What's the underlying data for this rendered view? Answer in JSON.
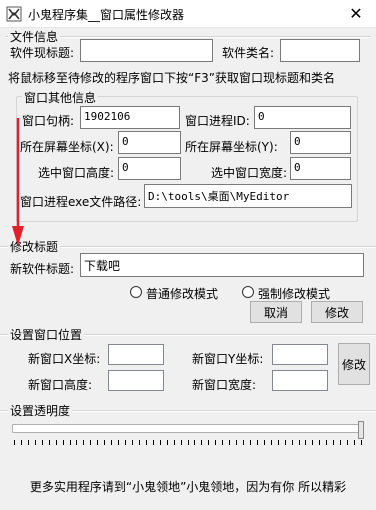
{
  "window": {
    "title": "小鬼程序集__窗口属性修改器",
    "close_glyph": "✕"
  },
  "file_info": {
    "legend": "文件信息",
    "caption_label": "软件现标题:",
    "caption_value": "",
    "class_label": "软件类名:",
    "class_value": "",
    "hint": "将鼠标移至待修改的程序窗口下按“F3”获取窗口现标题和类名"
  },
  "window_info": {
    "legend": "窗口其他信息",
    "handle_label": "窗口句柄:",
    "handle_value": "1902106",
    "pid_label": "窗口进程ID:",
    "pid_value": "0",
    "x_label": "所在屏幕坐标(X):",
    "x_value": "0",
    "y_label": "所在屏幕坐标(Y):",
    "y_value": "0",
    "height_label": "选中窗口高度:",
    "height_value": "0",
    "width_label": "选中窗口宽度:",
    "width_value": "0",
    "path_label": "窗口进程exe文件路径:",
    "path_value": "D:\\tools\\桌面\\MyEditor"
  },
  "modify_title": {
    "legend": "修改标题",
    "new_title_label": "新软件标题:",
    "new_title_value": "下载吧",
    "mode_normal": "普通修改模式",
    "mode_force": "强制修改模式",
    "cancel": "取消",
    "modify": "修改"
  },
  "position": {
    "legend": "设置窗口位置",
    "new_x_label": "新窗口X坐标:",
    "new_x_value": "",
    "new_y_label": "新窗口Y坐标:",
    "new_y_value": "",
    "new_h_label": "新窗口高度:",
    "new_h_value": "",
    "new_w_label": "新窗口宽度:",
    "new_w_value": "",
    "modify": "修改"
  },
  "transparency": {
    "legend": "设置透明度",
    "level": 1.0
  },
  "footer": "更多实用程序请到“小鬼领地”小鬼领地，因为有你 所以精彩",
  "colors": {
    "annotation_arrow": "#e0202a",
    "border": "#d5d5d5",
    "background": "#f0f0f0"
  }
}
